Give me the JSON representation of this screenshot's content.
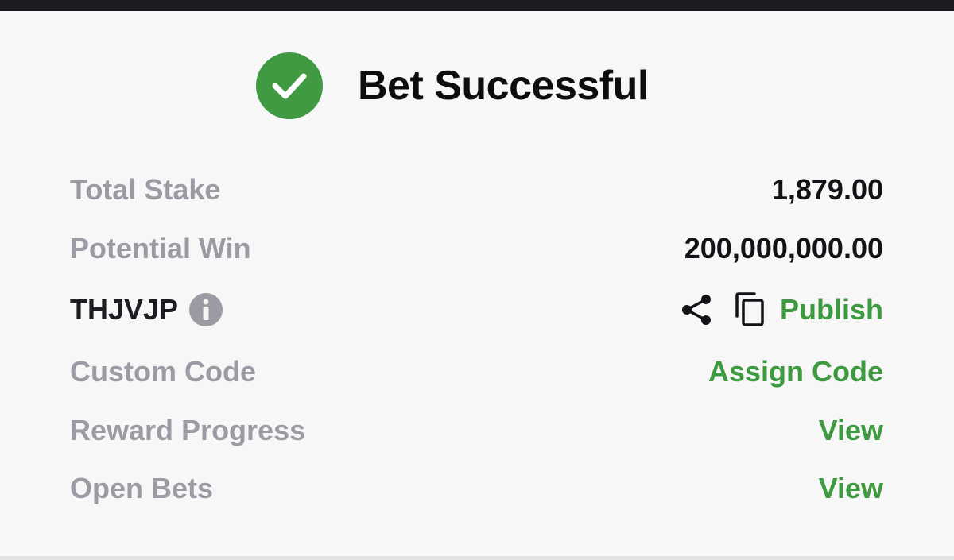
{
  "header": {
    "title": "Bet Successful",
    "status_icon": "check-circle-icon",
    "accent_color": "#3f9a41"
  },
  "details": {
    "total_stake": {
      "label": "Total Stake",
      "value": "1,879.00"
    },
    "potential_win": {
      "label": "Potential Win",
      "value": "200,000,000.00"
    },
    "booking": {
      "code": "THJVJP",
      "info_icon": "info-icon",
      "share_icon": "share-icon",
      "copy_icon": "copy-icon",
      "publish_label": "Publish"
    },
    "custom_code": {
      "label": "Custom Code",
      "action": "Assign Code"
    },
    "reward_progress": {
      "label": "Reward Progress",
      "action": "View"
    },
    "open_bets": {
      "label": "Open Bets",
      "action": "View"
    }
  }
}
